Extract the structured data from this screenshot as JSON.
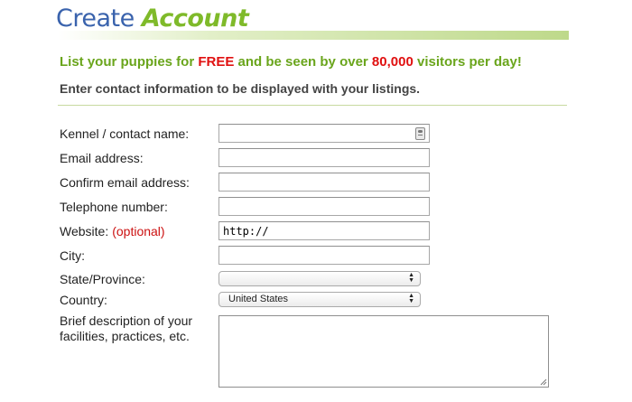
{
  "header": {
    "title_part1": "Create",
    "title_part2": "Account"
  },
  "promo": {
    "prefix": "List your puppies for ",
    "free": "FREE",
    "middle": " and be seen by over ",
    "count": "80,000",
    "suffix": " visitors per day!"
  },
  "subheading": "Enter contact information to be displayed with your listings.",
  "form": {
    "kennel_label": "Kennel / contact name:",
    "email_label": "Email address:",
    "confirm_email_label": "Confirm email address:",
    "telephone_label": "Telephone number:",
    "website_label": "Website:",
    "website_optional": "(optional)",
    "website_value": "http://",
    "city_label": "City:",
    "state_label": "State/Province:",
    "state_value": "",
    "country_label": "Country:",
    "country_value": "United States",
    "description_label": "Brief description of your facilities, practices, etc."
  },
  "colors": {
    "title_blue": "#3a63ad",
    "title_green": "#7fba2a",
    "promo_green": "#6aa51c",
    "highlight_red": "#e01010"
  }
}
